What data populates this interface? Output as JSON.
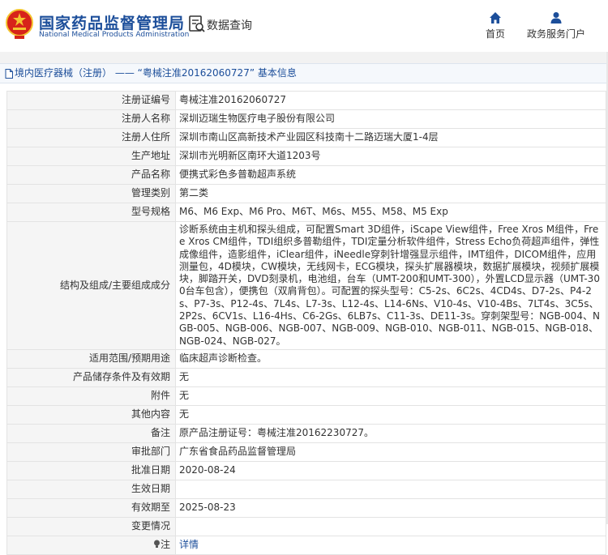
{
  "header": {
    "site_title": "国家药品监督管理局",
    "site_subtitle": "National Medical Products Administration",
    "query_label": "数据查询",
    "nav": {
      "home": "首页",
      "services": "政务服务门户"
    }
  },
  "breadcrumb": "境内医疗器械（注册） —— “粤械注准20162060727” 基本信息",
  "rows": [
    {
      "label": "注册证编号",
      "value": "粤械注准20162060727"
    },
    {
      "label": "注册人名称",
      "value": "深圳迈瑞生物医疗电子股份有限公司"
    },
    {
      "label": "注册人住所",
      "value": "深圳市南山区高新技术产业园区科技南十二路迈瑞大厦1-4层"
    },
    {
      "label": "生产地址",
      "value": "深圳市光明新区南环大道1203号"
    },
    {
      "label": "产品名称",
      "value": "便携式彩色多普勒超声系统"
    },
    {
      "label": "管理类别",
      "value": "第二类"
    },
    {
      "label": "型号规格",
      "value": "M6、M6 Exp、M6 Pro、M6T、M6s、M55、M58、M5 Exp"
    },
    {
      "label": "结构及组成/主要组成成分",
      "value": "诊断系统由主机和探头组成，可配置Smart 3D组件，iScape View组件，Free Xros M组件，Free Xros CM组件，TDI组织多普勒组件，TDI定量分析软件组件，Stress Echo负荷超声组件，弹性成像组件，造影组件，iClear组件，iNeedle穿刺针增强显示组件，IMT组件，DICOM组件，应用测量包，4D模块，CW模块，无线网卡，ECG模块，探头扩展器模块，数据扩展模块，视频扩展模块，脚踏开关，DVD刻录机，电池组，台车（UMT-200和UMT-300），外置LCD显示器（UMT-300台车包含），便携包（双肩背包）。可配置的探头型号：C5-2s、6C2s、4CD4s、D7-2s、P4-2s、P7-3s、P12-4s、7L4s、L7-3s、L12-4s、L14-6Ns、V10-4s、V10-4Bs、7LT4s、3C5s、2P2s、6CV1s、L16-4Hs、C6-2Gs、6LB7s、C11-3s、DE11-3s。穿刺架型号：NGB-004、NGB-005、NGB-006、NGB-007、NGB-009、NGB-010、NGB-011、NGB-015、NGB-018、NGB-024、NGB-027。"
    },
    {
      "label": "适用范围/预期用途",
      "value": "临床超声诊断检查。"
    },
    {
      "label": "产品储存条件及有效期",
      "value": "无"
    },
    {
      "label": "附件",
      "value": "无"
    },
    {
      "label": "其他内容",
      "value": "无"
    },
    {
      "label": "备注",
      "value": "原产品注册证号：粤械注准20162230727。"
    },
    {
      "label": "审批部门",
      "value": "广东省食品药品监督管理局"
    },
    {
      "label": "批准日期",
      "value": "2020-08-24"
    },
    {
      "label": "生效日期",
      "value": ""
    },
    {
      "label": "有效期至",
      "value": "2025-08-23"
    },
    {
      "label": "变更情况",
      "value": ""
    }
  ],
  "note": {
    "label": "注",
    "link": "详情"
  },
  "colors": {
    "brand_blue": "#1c4e9a",
    "emblem_red": "#d7231a",
    "emblem_gold": "#f4c430"
  }
}
